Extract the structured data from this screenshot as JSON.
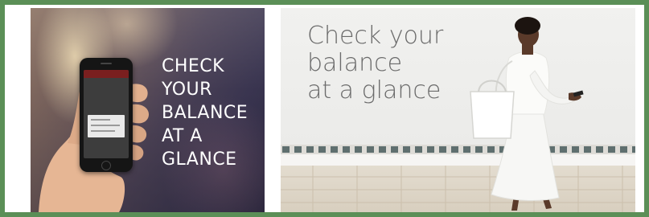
{
  "banner": {
    "left_panel": {
      "caption_lines": [
        "CHECK",
        "YOUR",
        "BALANCE",
        "AT A",
        "GLANCE"
      ]
    },
    "right_panel": {
      "caption_lines": [
        "Check your",
        "balance",
        "at a glance"
      ]
    }
  },
  "colors": {
    "frame_border": "#5b8f57",
    "left_caption": "#ffffff",
    "right_caption": "#6b6b6b"
  }
}
